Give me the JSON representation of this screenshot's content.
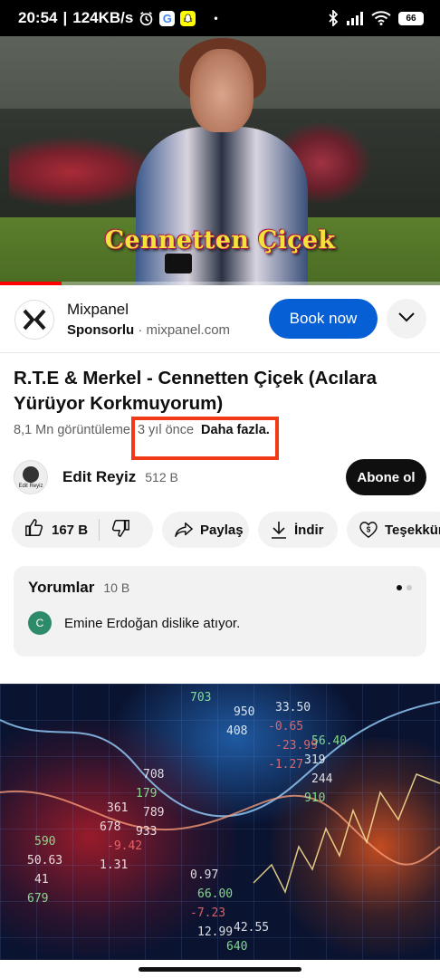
{
  "status_bar": {
    "time": "20:54",
    "speed": "124KB/s",
    "dot": "•",
    "battery": "66",
    "icons": [
      "alarm-icon",
      "google-icon",
      "snapchat-icon",
      "bluetooth-icon",
      "signal-icon",
      "wifi-icon",
      "battery-icon"
    ]
  },
  "video": {
    "overlay_title": "Cennetten Çiçek",
    "progress_fraction": 0.14
  },
  "ad": {
    "logo_glyph": "X",
    "name": "Mixpanel",
    "sponsored": "Sponsorlu",
    "separator": "·",
    "domain": "mixpanel.com",
    "cta": "Book now"
  },
  "video_info": {
    "title": "R.T.E & Merkel - Cennetten Çiçek (Acılara Yürüyor Korkmuyorum)",
    "views": "8,1 Mn görüntüleme",
    "age": "3 yıl önce",
    "more": "Daha fazla."
  },
  "channel": {
    "avatar_text": "Edit Reyiz",
    "name": "Edit Reyiz",
    "subscribers": "512 B",
    "subscribe_label": "Abone ol"
  },
  "actions": {
    "likes": "167 B",
    "share": "Paylaş",
    "download": "İndir",
    "thanks": "Teşekkürler"
  },
  "comments": {
    "label": "Yorumlar",
    "count": "10 B",
    "avatar_letter": "C",
    "text": "Emine Erdoğan dislike atıyor."
  },
  "thumbnail_numbers": [
    "703",
    "408",
    "-1.27",
    "910",
    "933",
    "1.31",
    "679",
    "12.99",
    "950",
    "-23.99",
    "244",
    "789",
    "-9.42",
    "41",
    "-7.23",
    "640",
    "-0.65",
    "319",
    "179",
    "678",
    "50.63",
    "66.00",
    "42.55",
    "33.50",
    "56.40",
    "708",
    "361",
    "590",
    "0.97"
  ]
}
